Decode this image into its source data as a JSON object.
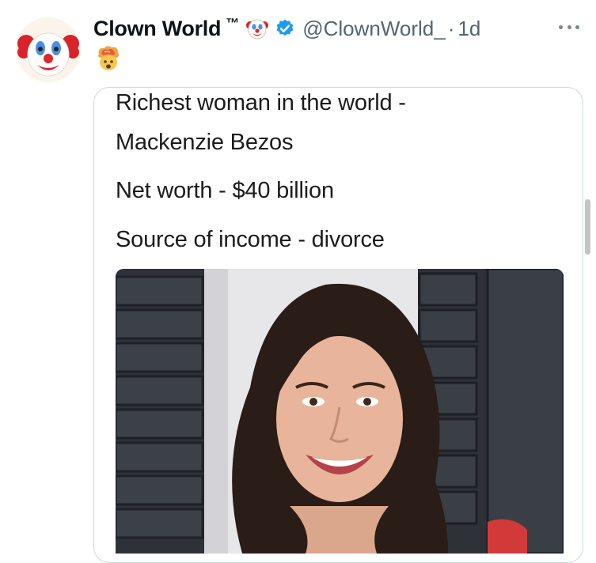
{
  "tweet": {
    "display_name": "Clown World",
    "trademark": "™",
    "handle": "@ClownWorld_",
    "separator": "·",
    "time": "1d",
    "name_emoji_icon": "clown-face-icon",
    "body_emoji_icon": "exploding-head-icon",
    "verified_icon": "verified-badge-icon",
    "accent_color": "#1d9bf0"
  },
  "meme": {
    "lines": [
      "Richest woman in the world -",
      "Mackenzie Bezos",
      "Net worth - $40 billion",
      "Source of income - divorce"
    ]
  }
}
